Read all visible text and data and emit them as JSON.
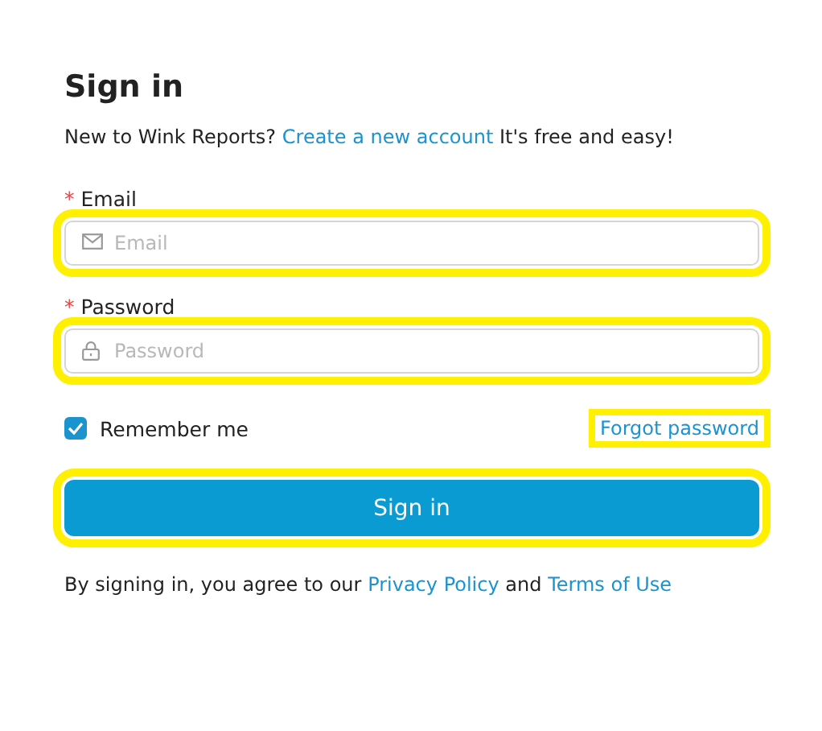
{
  "title": "Sign in",
  "intro": {
    "text": "New to Wink Reports?",
    "link": "Create a new account",
    "after": "It's free and easy!"
  },
  "fields": [
    {
      "label": "Email",
      "required_mark": "*",
      "kind": "email",
      "placeholder": "Email",
      "highlighted": true
    },
    {
      "label": "Password",
      "required_mark": "*",
      "kind": "password",
      "placeholder": "Password",
      "highlighted": true
    }
  ],
  "remember": {
    "label": "Remember me",
    "checked": true
  },
  "forgot_link": {
    "text": "Forgot password",
    "highlighted": true
  },
  "submit_button": {
    "label": "Sign in",
    "highlighted": true
  },
  "footer": {
    "text": "By signing in, you agree to our",
    "link1": "Privacy Policy",
    "middle": "and",
    "link2": "Terms of Use"
  }
}
